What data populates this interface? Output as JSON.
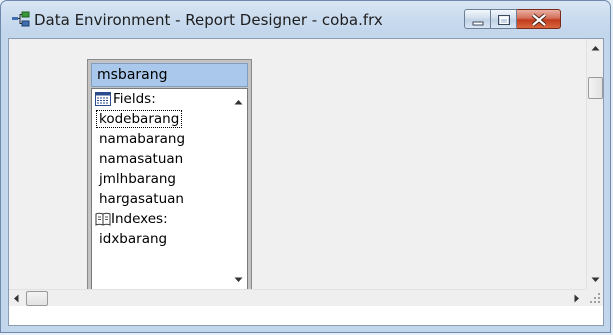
{
  "window": {
    "title": "Data Environment - Report Designer - coba.frx",
    "controls": {
      "minimize": "minimize-icon",
      "maximize": "maximize-icon",
      "close": "close-icon"
    }
  },
  "table": {
    "name": "msbarang",
    "fields_label": "Fields:",
    "fields": [
      "kodebarang",
      "namabarang",
      "namasatuan",
      "jmlhbarang",
      "hargasatuan"
    ],
    "selected_field": "kodebarang",
    "indexes_label": "Indexes:",
    "indexes": [
      "idxbarang"
    ]
  },
  "colors": {
    "header_bg": "#a9c8ec",
    "close_button": "#c23b1e",
    "canvas": "#f0f0f0"
  }
}
